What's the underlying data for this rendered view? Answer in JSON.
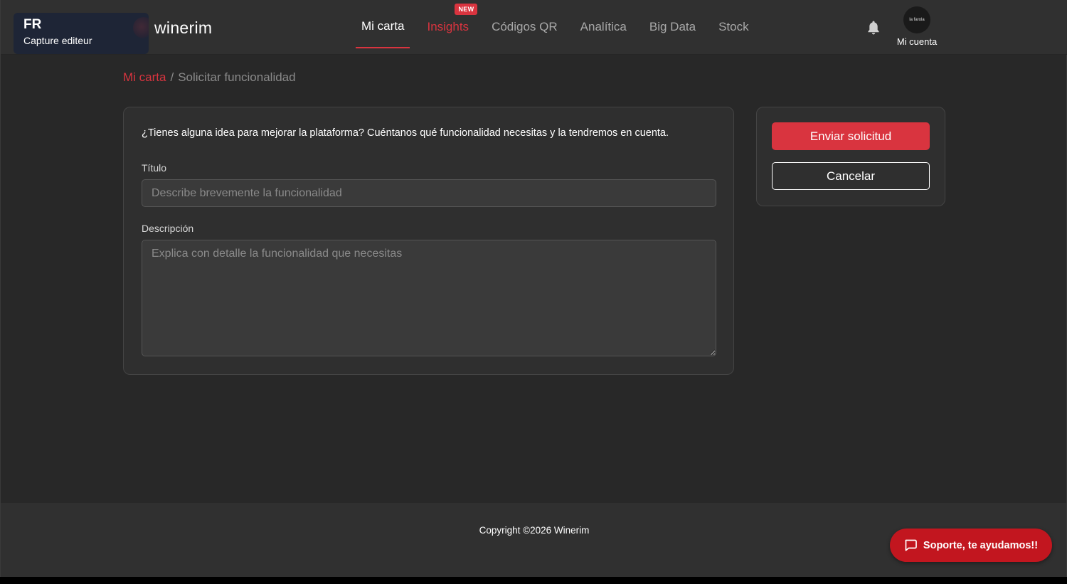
{
  "header": {
    "org_code": "FR",
    "org_subtitle": "Capture editeur",
    "logo": "winerim",
    "nav": [
      {
        "label": "Mi carta",
        "state": "active"
      },
      {
        "label": "Insights",
        "badge": "NEW",
        "state": "highlight"
      },
      {
        "label": "Códigos QR"
      },
      {
        "label": "Analítica"
      },
      {
        "label": "Big Data"
      },
      {
        "label": "Stock"
      }
    ],
    "notification_icon": "bell-icon",
    "account_label": "Mi cuenta",
    "avatar_text": "la farola"
  },
  "breadcrumb": {
    "parent": "Mi carta",
    "separator": "/",
    "current": "Solicitar funcionalidad"
  },
  "form": {
    "intro": "¿Tienes alguna idea para mejorar la plataforma? Cuéntanos qué funcionalidad necesitas y la tendremos en cuenta.",
    "title_label": "Título",
    "title_placeholder": "Describe brevemente la funcionalidad",
    "title_value": "",
    "description_label": "Descripción",
    "description_placeholder": "Explica con detalle la funcionalidad que necesitas",
    "description_value": ""
  },
  "actions": {
    "submit_label": "Enviar solicitud",
    "cancel_label": "Cancelar"
  },
  "footer": {
    "copyright": "Copyright ©2026 Winerim",
    "support_label": "Soporte, te ayudamos!!",
    "support_icon": "chat-bubble-icon"
  },
  "colors": {
    "accent": "#d9343f",
    "background": "#282828",
    "card": "#2f2f2f",
    "header": "#303030",
    "support": "#c2161f"
  }
}
